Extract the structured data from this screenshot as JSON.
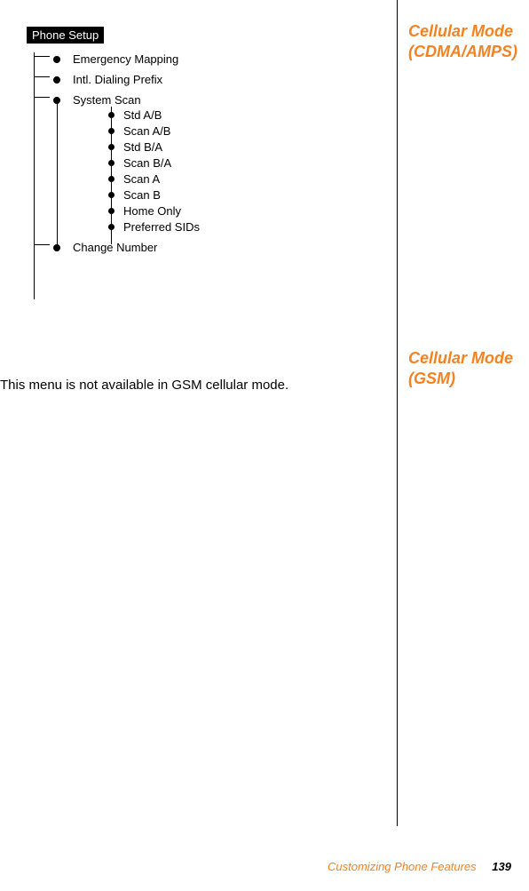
{
  "menu": {
    "root": "Phone Setup",
    "items": [
      "Emergency Mapping",
      "Intl. Dialing Prefix",
      "System Scan",
      "Change Number"
    ],
    "systemScanChildren": [
      "Std A/B",
      "Scan A/B",
      "Std B/A",
      "Scan B/A",
      "Scan A",
      "Scan B",
      "Home Only",
      "Preferred SIDs"
    ]
  },
  "side": {
    "cdma": "Cellular Mode (CDMA/AMPS)",
    "gsm": "Cellular Mode (GSM)"
  },
  "gsmText": "This menu is not available in GSM cellular mode.",
  "footer": {
    "section": "Customizing Phone Features",
    "page": "139"
  }
}
